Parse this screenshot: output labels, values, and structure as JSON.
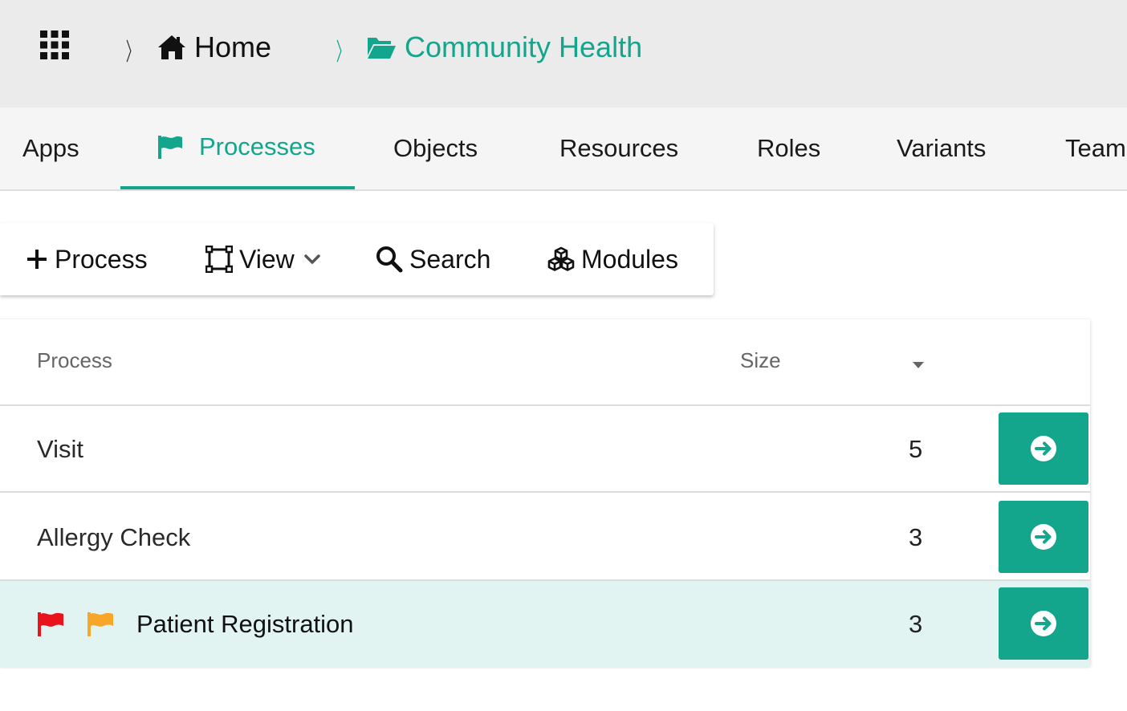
{
  "colors": {
    "accent": "#14a58d",
    "flag_red": "#e8131b",
    "flag_orange": "#f7a62a",
    "highlight_row": "#e2f4f2"
  },
  "breadcrumb": {
    "apps_icon": "apps-grid-icon",
    "home": {
      "label": "Home",
      "icon": "home-icon"
    },
    "current": {
      "label": "Community Health",
      "icon": "folder-open-icon"
    }
  },
  "tabs": [
    {
      "label": "Apps",
      "active": false
    },
    {
      "label": "Processes",
      "active": true,
      "icon": "flag-icon"
    },
    {
      "label": "Objects",
      "active": false
    },
    {
      "label": "Resources",
      "active": false
    },
    {
      "label": "Roles",
      "active": false
    },
    {
      "label": "Variants",
      "active": false
    },
    {
      "label": "Team",
      "active": false
    }
  ],
  "toolbar": {
    "add_process": {
      "label": "Process",
      "icon": "plus-icon"
    },
    "view": {
      "label": "View",
      "icon": "expand-icon",
      "dropdown_icon": "chevron-down-icon"
    },
    "search": {
      "label": "Search",
      "icon": "search-icon"
    },
    "modules": {
      "label": "Modules",
      "icon": "cubes-icon"
    }
  },
  "table": {
    "columns": [
      "Process",
      "Size"
    ],
    "sort_icon": "caret-down-icon",
    "rows": [
      {
        "name": "Visit",
        "size": "5",
        "flags": [],
        "action_icon": "arrow-circle-right-icon"
      },
      {
        "name": "Allergy Check",
        "size": "3",
        "flags": [],
        "action_icon": "arrow-circle-right-icon"
      },
      {
        "name": "Patient Registration",
        "size": "3",
        "flags": [
          "red",
          "orange"
        ],
        "highlighted": true,
        "action_icon": "arrow-circle-right-icon"
      }
    ]
  }
}
